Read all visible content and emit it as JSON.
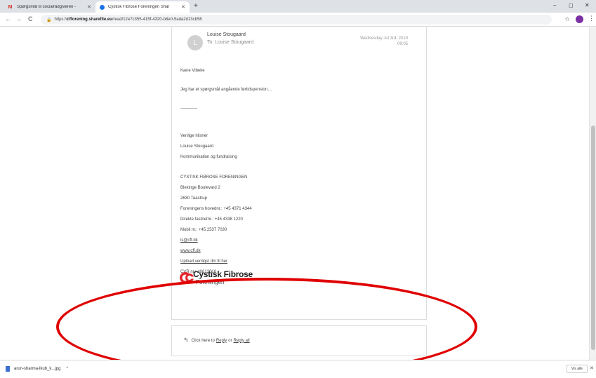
{
  "browser": {
    "tabs": [
      {
        "title": "Spørgsmål til socialrådgiveren - ",
        "icon": "gmail-icon",
        "favicon_glyph": "M",
        "active": false
      },
      {
        "title": "Cystisk Fibrose Foreningen Shar",
        "icon": "sharefile-icon",
        "active": true
      }
    ],
    "new_tab": "+",
    "window_controls": {
      "minimize": "–",
      "maximize": "◻",
      "close": "✕"
    },
    "tab_close": "✕",
    "nav": {
      "back": "←",
      "forward": "→",
      "reload": "C"
    },
    "url": {
      "scheme": "https://",
      "host": "cfforening.sharefile.eu",
      "path": "/read/12e7c355-415f-4320-b8e0-5ada2d13cb58"
    },
    "star": "☆",
    "menu": "⋮"
  },
  "email": {
    "avatar_letter": "L",
    "sender": "Louise Stougaard",
    "recipient_line": "To: Louise Stougaard",
    "date_line1": "Wednesday Jul 3rd, 2019",
    "date_line2": "09:05",
    "greeting": "Kære Vibeke",
    "message": "Jeg har et spørgsmål angående førtidspension…",
    "closing": "Venlige hilsner",
    "name": "Louise Stougaard",
    "title": "Kommunikation og fundraising",
    "org": "CYSTISK FIBROSE FORENINGEN",
    "address1": "Blekinge Boulevard 2",
    "address2": "2630 Taastrup",
    "main_phone": "Foreningens hovednr.: +45 4371 4344",
    "direct_phone": "Direkte fastnetnr.: +45 4338 1220",
    "mobile": "Mobil nr.: +45 2537 7030",
    "email_link": "ls@cff.dk",
    "web_link": "www.cff.dk",
    "upload_link": "Upload venligst din fil her",
    "cvr": "CVR nr.: 40612016",
    "logo_name": "Cystisk Fibrose",
    "logo_sub": "Foreningen"
  },
  "reply": {
    "arrow": "↰",
    "prefix": "Click here to",
    "reply_link": "Reply",
    "or": "or",
    "reply_all_link": "Reply all"
  },
  "downloads": {
    "file": "arun-sharma-lkub_k...jpg",
    "chevron": "^",
    "show_all": "Vis alle",
    "close": "✕"
  },
  "colors": {
    "annotation": "#e00000",
    "logo_red": "#e3242b",
    "profile": "#7b2fa3"
  }
}
